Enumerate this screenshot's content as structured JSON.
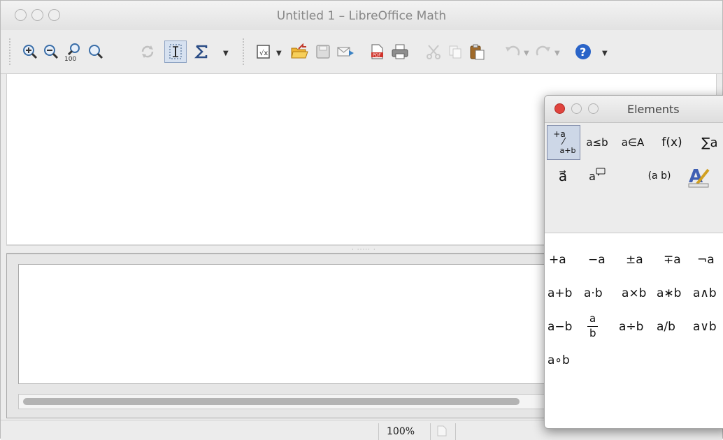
{
  "window": {
    "title": "Untitled 1 – LibreOffice Math"
  },
  "toolbar": {
    "icons": [
      "zoom-in-icon",
      "zoom-out-icon",
      "zoom-100-icon",
      "show-all-icon",
      "update-icon",
      "formula-cursor-icon",
      "symbols-icon",
      "insert-formula-icon",
      "open-folder-icon",
      "save-icon",
      "send-email-icon",
      "export-pdf-icon",
      "print-icon",
      "cut-icon",
      "copy-icon",
      "paste-icon",
      "undo-icon",
      "redo-icon",
      "help-icon"
    ],
    "zoom_100_label": "100"
  },
  "status": {
    "zoom": "100%"
  },
  "elements_panel": {
    "title": "Elements",
    "categories_row1": [
      {
        "top": "+a",
        "bottom": "a+b"
      },
      {
        "label": "a≤b"
      },
      {
        "label": "a∈A"
      },
      {
        "label": "f(x)"
      },
      {
        "label": "∑a"
      }
    ],
    "categories_row2": [
      {
        "label": "a⃗"
      },
      {
        "label": "a"
      },
      {
        "label": "(a b)"
      },
      {
        "icon": "format-attributes-icon"
      }
    ],
    "unary_ops": [
      "+a",
      "−a",
      "±a",
      "∓a",
      "¬a"
    ],
    "binary_row1": [
      "a+b",
      "a⋅b",
      "a×b",
      "a∗b",
      "a∧b"
    ],
    "binary_row2": [
      "a−b",
      "a",
      "b",
      "a÷b",
      "a/b",
      "a∨b"
    ],
    "binary_row3": [
      "a∘b"
    ]
  },
  "colors": {
    "panel_close": "#e0443e",
    "accent_selection": "#cdd7e7",
    "help_blue": "#2a64c8"
  }
}
